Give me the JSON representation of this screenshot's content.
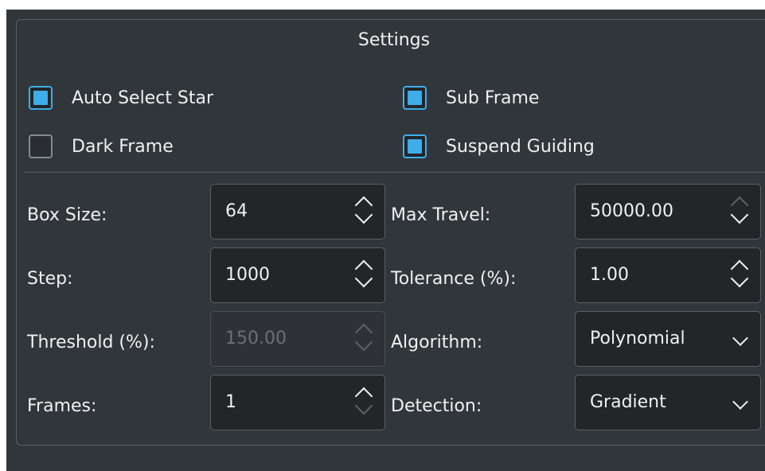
{
  "group": {
    "title": "Settings"
  },
  "checkboxes": [
    {
      "label": "Auto Select Star",
      "checked": true
    },
    {
      "label": "Sub Frame",
      "checked": true
    },
    {
      "label": "Dark Frame",
      "checked": false
    },
    {
      "label": "Suspend Guiding",
      "checked": true
    }
  ],
  "fields": {
    "box_size": {
      "label": "Box Size:",
      "value": "64",
      "enabled": true
    },
    "step": {
      "label": "Step:",
      "value": "1000",
      "enabled": true
    },
    "threshold": {
      "label": "Threshold (%):",
      "value": "150.00",
      "enabled": false
    },
    "frames": {
      "label": "Frames:",
      "value": "1",
      "enabled": true
    },
    "max_travel": {
      "label": "Max Travel:",
      "value": "50000.00",
      "enabled": true
    },
    "tolerance": {
      "label": "Tolerance (%):",
      "value": "1.00",
      "enabled": true
    },
    "algorithm": {
      "label": "Algorithm:",
      "value": "Polynomial"
    },
    "detection": {
      "label": "Detection:",
      "value": "Gradient"
    }
  },
  "icons": {
    "spin_arrows": "chevron-up-down-icon",
    "combo_arrow": "chevron-down-icon"
  },
  "colors": {
    "background": "#31363b",
    "accent": "#3daee9",
    "field_bg": "#232629",
    "border": "#5a5f64",
    "text": "#eff0f1"
  }
}
